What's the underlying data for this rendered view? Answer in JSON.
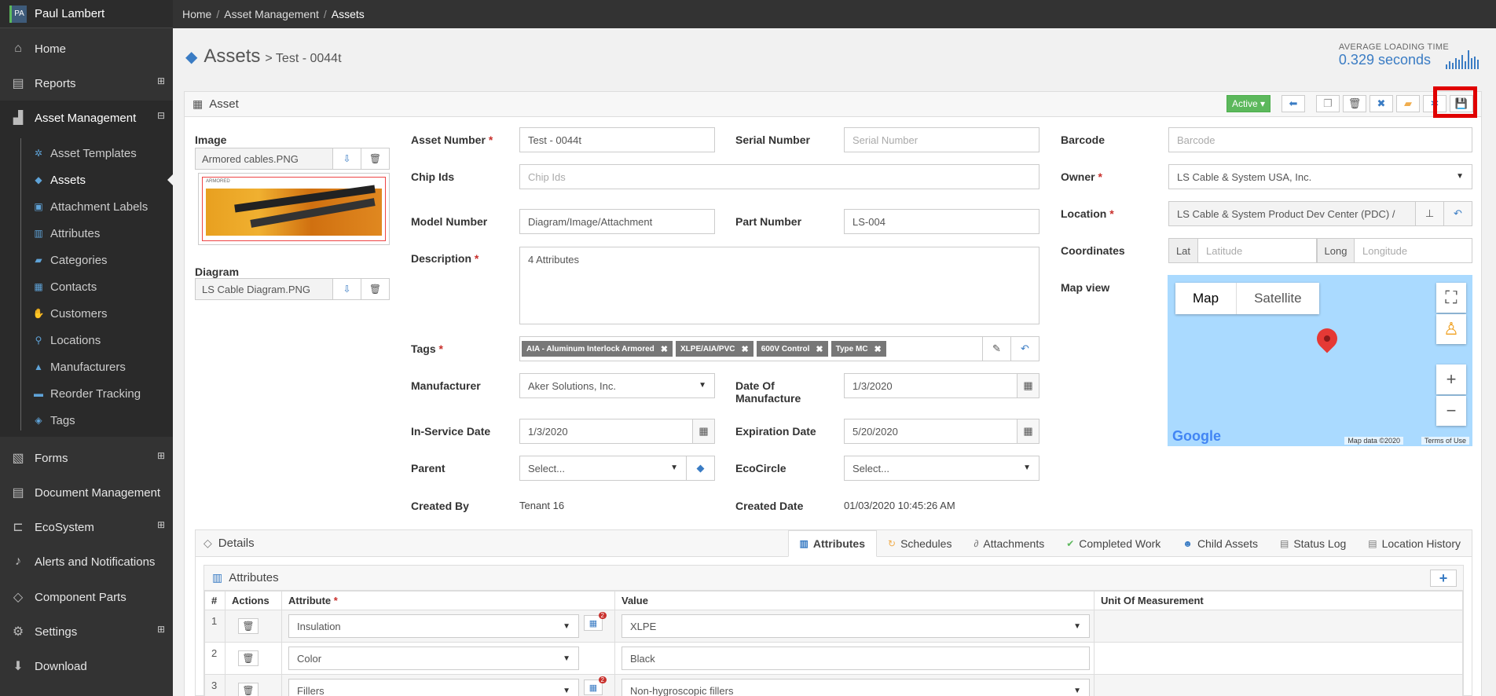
{
  "user": {
    "initials": "PA",
    "name": "Paul Lambert"
  },
  "nav": {
    "home": "Home",
    "reports": "Reports",
    "asset_management": "Asset Management",
    "sub": [
      "Asset Templates",
      "Assets",
      "Attachment Labels",
      "Attributes",
      "Categories",
      "Contacts",
      "Customers",
      "Locations",
      "Manufacturers",
      "Reorder Tracking",
      "Tags"
    ],
    "forms": "Forms",
    "document_management": "Document Management",
    "ecosystem": "EcoSystem",
    "alerts": "Alerts and Notifications",
    "component_parts": "Component Parts",
    "settings": "Settings",
    "download": "Download"
  },
  "breadcrumb": {
    "home": "Home",
    "asset_management": "Asset Management",
    "current": "Assets"
  },
  "header": {
    "title": "Assets",
    "subtitle": "> Test - 0044t"
  },
  "loading": {
    "label": "AVERAGE LOADING TIME",
    "value": "0.329 seconds"
  },
  "panel": {
    "title": "Asset",
    "status": "Active ▾"
  },
  "image": {
    "label": "Image",
    "file": "Armored cables.PNG",
    "preview_label": "ARMORED"
  },
  "diagram": {
    "label": "Diagram",
    "file": "LS Cable Diagram.PNG"
  },
  "form": {
    "asset_number": {
      "label": "Asset Number",
      "value": "Test - 0044t"
    },
    "serial_number": {
      "label": "Serial Number",
      "placeholder": "Serial Number"
    },
    "barcode": {
      "label": "Barcode",
      "placeholder": "Barcode"
    },
    "chip_ids": {
      "label": "Chip Ids",
      "placeholder": "Chip Ids"
    },
    "owner": {
      "label": "Owner",
      "value": "LS Cable & System USA, Inc."
    },
    "model_number": {
      "label": "Model Number",
      "value": "Diagram/Image/Attachment"
    },
    "part_number": {
      "label": "Part Number",
      "value": "LS-004"
    },
    "location": {
      "label": "Location",
      "value": "LS Cable & System Product Dev Center (PDC) /"
    },
    "description": {
      "label": "Description",
      "value": "4 Attributes"
    },
    "coordinates": {
      "label": "Coordinates",
      "lat": "Lat",
      "lat_placeholder": "Latitude",
      "long": "Long",
      "long_placeholder": "Longitude"
    },
    "map_view": {
      "label": "Map view"
    },
    "tags": {
      "label": "Tags",
      "items": [
        "AIA - Aluminum Interlock Armored",
        "XLPE/AIA/PVC",
        "600V Control",
        "Type MC"
      ]
    },
    "manufacturer": {
      "label": "Manufacturer",
      "value": "Aker Solutions, Inc."
    },
    "date_of_manufacture": {
      "label1": "Date Of",
      "label2": "Manufacture",
      "value": "1/3/2020"
    },
    "in_service_date": {
      "label": "In-Service Date",
      "value": "1/3/2020"
    },
    "expiration_date": {
      "label": "Expiration Date",
      "value": "5/20/2020"
    },
    "parent": {
      "label": "Parent",
      "value": "Select..."
    },
    "ecocircle": {
      "label": "EcoCircle",
      "value": "Select..."
    },
    "created_by": {
      "label": "Created By",
      "value": "Tenant 16"
    },
    "created_date": {
      "label": "Created Date",
      "value": "01/03/2020 10:45:26 AM"
    }
  },
  "map": {
    "tab_map": "Map",
    "tab_satellite": "Satellite",
    "logo": "Google",
    "data": "Map data ©2020",
    "terms": "Terms of Use"
  },
  "details": {
    "title": "Details",
    "tabs": [
      "Attributes",
      "Schedules",
      "Attachments",
      "Completed Work",
      "Child Assets",
      "Status Log",
      "Location History"
    ],
    "attributes_title": "Attributes",
    "columns": [
      "#",
      "Actions",
      "Attribute",
      "Value",
      "Unit Of Measurement"
    ],
    "rows": [
      {
        "n": "1",
        "attribute": "Insulation",
        "value": "XLPE",
        "badge": "2"
      },
      {
        "n": "2",
        "attribute": "Color",
        "value": "Black",
        "badge": ""
      },
      {
        "n": "3",
        "attribute": "Fillers",
        "value": "Non-hygroscopic fillers",
        "badge": "2"
      }
    ]
  }
}
